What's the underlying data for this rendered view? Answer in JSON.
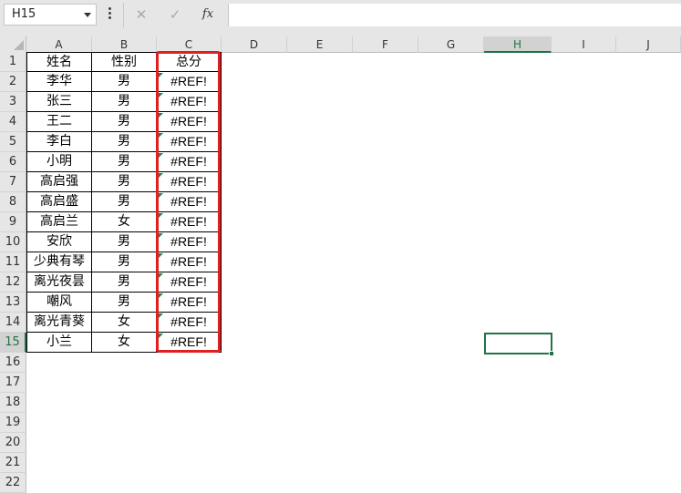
{
  "formula_bar": {
    "name_box": "H15",
    "cancel_icon": "✕",
    "enter_icon": "✓",
    "function_icon": "fx",
    "formula": ""
  },
  "sheet": {
    "columns": [
      "A",
      "B",
      "C",
      "D",
      "E",
      "F",
      "G",
      "H",
      "I",
      "J"
    ],
    "rows": [
      "1",
      "2",
      "3",
      "4",
      "5",
      "6",
      "7",
      "8",
      "9",
      "10",
      "11",
      "12",
      "13",
      "14",
      "15",
      "16",
      "17",
      "18",
      "19",
      "20",
      "21",
      "22"
    ],
    "selected_column": "H",
    "selected_row": "15",
    "active_cell": "H15",
    "accent_color": "#217346",
    "highlight_color": "#e02020",
    "error_indicator_color": "#1e8a3c",
    "table": {
      "header": [
        "姓名",
        "性别",
        "总分"
      ],
      "rows": [
        [
          "李华",
          "男",
          "#REF!"
        ],
        [
          "张三",
          "男",
          "#REF!"
        ],
        [
          "王二",
          "男",
          "#REF!"
        ],
        [
          "李白",
          "男",
          "#REF!"
        ],
        [
          "小明",
          "男",
          "#REF!"
        ],
        [
          "高启强",
          "男",
          "#REF!"
        ],
        [
          "高启盛",
          "男",
          "#REF!"
        ],
        [
          "高启兰",
          "女",
          "#REF!"
        ],
        [
          "安欣",
          "男",
          "#REF!"
        ],
        [
          "少典有琴",
          "男",
          "#REF!"
        ],
        [
          "离光夜昙",
          "男",
          "#REF!"
        ],
        [
          "嘲风",
          "男",
          "#REF!"
        ],
        [
          "离光青葵",
          "女",
          "#REF!"
        ],
        [
          "小兰",
          "女",
          "#REF!"
        ]
      ]
    }
  }
}
